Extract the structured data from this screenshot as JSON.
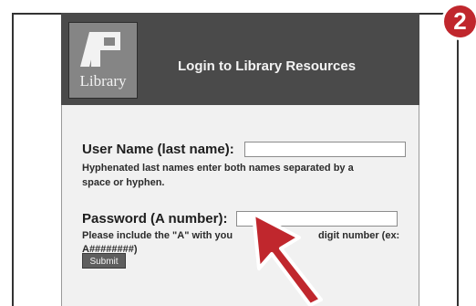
{
  "step_badge": "2",
  "logo": {
    "text": "Library",
    "alt": "AP"
  },
  "header": {
    "title": "Login to Library Resources"
  },
  "form": {
    "username_label": "User Name (last name):",
    "username_value": "",
    "username_note_line1": "Hyphenated last names enter both names separated by a",
    "username_note_line2": "space or hyphen.",
    "password_label": "Password (A number):",
    "password_value": "",
    "password_note_line1": "Please include the \"A\" with you",
    "password_note_line1b": "digit number (ex:",
    "password_note_line2": "A########)",
    "submit_label": "Submit"
  },
  "colors": {
    "badge": "#c0272d",
    "header_bg": "#4a4a4a",
    "cursor": "#c0272d"
  },
  "icons": {
    "pointer": "arrow-cursor-icon"
  }
}
